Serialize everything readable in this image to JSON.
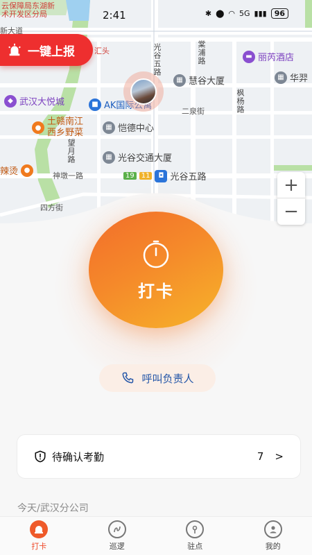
{
  "status": {
    "time": "2:41",
    "network": "5G",
    "battery": "96"
  },
  "map": {
    "labels": {
      "top_banner": "云保障局东湖新",
      "top_banner2": "术开发区分局",
      "road_top": "新大道",
      "gaoxin_road": "高新大道",
      "guanggu_5": "光谷五路",
      "tangpu": "棠浦路",
      "fengyang": "枫杨路",
      "erquan": "二泉街",
      "shenduan": "神墩一路",
      "guanggu5_bottom": "光谷五路",
      "sifang": "四方街",
      "wangyue": "望月路",
      "hui": "汇头"
    },
    "pois": {
      "hotel": "丽芮酒店",
      "huiguo": "慧谷大厦",
      "huaxiang": "华羿",
      "wuhan_joy": "武汉大悦城",
      "ak": "AK国际公寓",
      "tugan": "土赣南江",
      "tugan2": "西乡野菜",
      "kaide": "恺德中心",
      "guanggu_jiaotong": "光谷交通大厦",
      "la": "辣烫",
      "metro": "光谷五路",
      "metro_lines": [
        "19",
        "11"
      ]
    },
    "zoom_in": "+",
    "zoom_out": "−"
  },
  "report_button": "一键上报",
  "punch": {
    "label": "打卡"
  },
  "call_label": "呼叫负责人",
  "pending": {
    "title": "待确认考勤",
    "count": "7",
    "chevron": ">"
  },
  "today_label": "今天/武汉分公司",
  "tabs": [
    {
      "label": "打卡",
      "icon": "punch-icon"
    },
    {
      "label": "巡逻",
      "icon": "patrol-icon"
    },
    {
      "label": "驻点",
      "icon": "station-icon"
    },
    {
      "label": "我的",
      "icon": "profile-icon"
    }
  ],
  "colors": {
    "accent": "#ef5a2a",
    "report_red": "#ee2f2f",
    "link_blue": "#2456a8"
  }
}
